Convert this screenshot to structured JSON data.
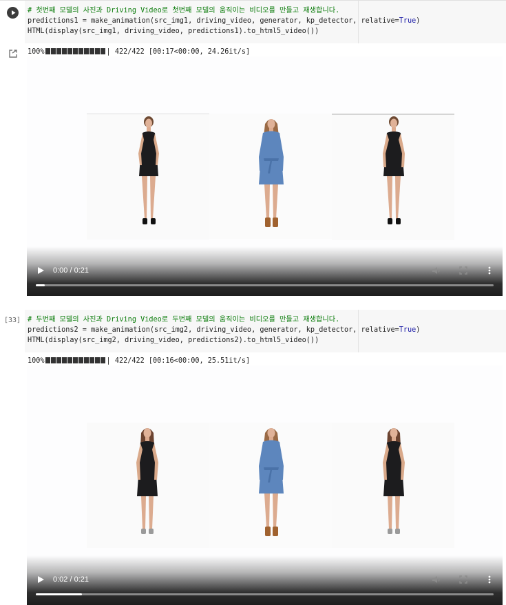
{
  "cell1": {
    "code": [
      "# 첫번째 모델의 사진과 Driving Video로 첫번째 모델의 움직이는 비디오를 만들고 재생합니다.",
      "predictions1 = make_animation(src_img1, driving_video, generator, kp_detector, relative=",
      "HTML(display(src_img1, driving_video, predictions1).to_html5_video())"
    ],
    "relative_value": "True",
    "progress": {
      "percent": "100%",
      "rest": "| 422/422 [00:17<00:00, 24.26it/s]"
    },
    "video": {
      "time": "0:00 / 0:21",
      "played_fraction": 0.02
    }
  },
  "cell2": {
    "exec_count": "[33]",
    "code": [
      "# 두번째 모델의 사진과 Driving Video로 두번째 모델의 움직이는 비디오를 만들고 재생합니다.",
      "predictions2 = make_animation(src_img2, driving_video, generator, kp_detector, relative=",
      "HTML(display(src_img2, driving_video, predictions2).to_html5_video())"
    ],
    "relative_value": "True",
    "progress": {
      "percent": "100%",
      "rest": "| 422/422 [00:16<00:00, 25.51it/s]"
    },
    "video": {
      "time": "0:02 / 0:21",
      "played_fraction": 0.1
    }
  },
  "icons": {
    "run": "play-circle-icon",
    "output": "output-arrow-icon",
    "video_play": "play-icon",
    "volume": "volume-icon",
    "fullscreen": "fullscreen-icon",
    "menu": "more-vert-icon"
  },
  "colors": {
    "black_dress": "#1c1c1e",
    "denim_dress": "#5d86bd",
    "skin": "#d9a98a",
    "hair_brown": "#7a5238",
    "code_bg": "#f7f7f7",
    "comment": "#0d7d0d"
  }
}
